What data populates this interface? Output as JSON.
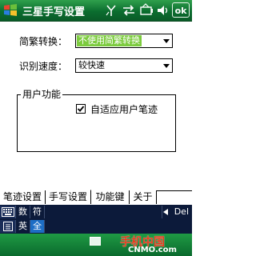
{
  "window": {
    "title": "三星手写设置",
    "ok_label": "ok"
  },
  "status_icons": [
    "antenna-icon",
    "sync-icon",
    "battery-icon",
    "speaker-icon"
  ],
  "form": {
    "conversion": {
      "label": "简繁转换：",
      "value": "不使用简繁转换"
    },
    "speed": {
      "label": "识别速度：",
      "value": "较快速"
    },
    "group": {
      "legend": "用户功能",
      "checkbox_label": "自适应用户笔迹",
      "checked": true
    }
  },
  "tabs": [
    {
      "label": "笔迹设置",
      "active": false
    },
    {
      "label": "手写设置",
      "active": true
    },
    {
      "label": "功能键",
      "active": false
    },
    {
      "label": "关于",
      "active": false
    }
  ],
  "sip": {
    "row1": [
      "数",
      "符"
    ],
    "row2": [
      "英",
      "全"
    ],
    "del_label": "Del"
  },
  "brand": {
    "logo": "手机中国",
    "url": "CNMO.com"
  },
  "colors": {
    "titlebar": "#0b6d2f",
    "selection": "#7ccb3e",
    "sip_bg": "#0c1a3a"
  }
}
